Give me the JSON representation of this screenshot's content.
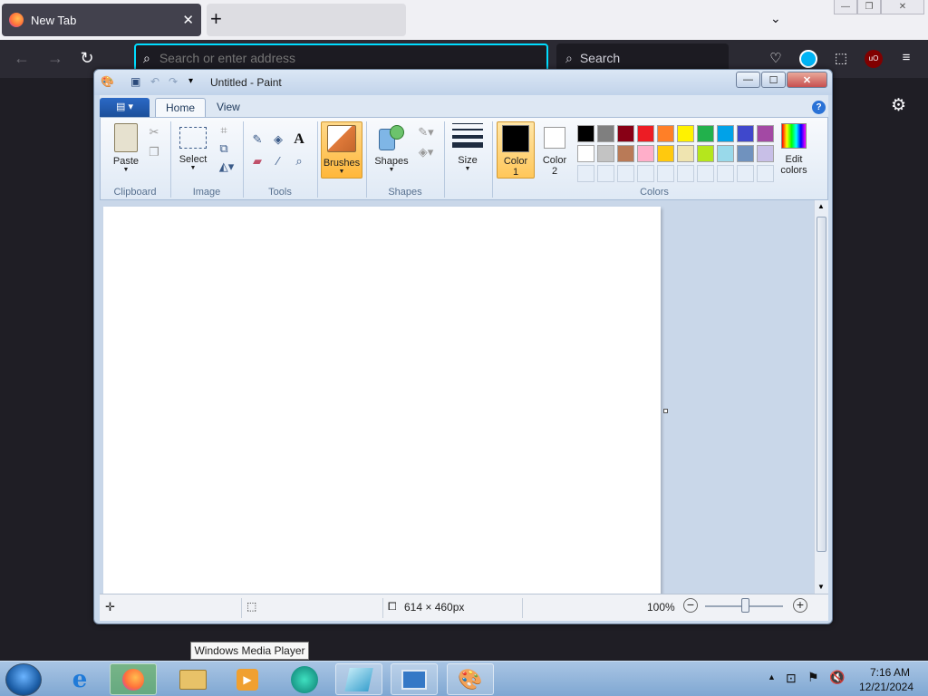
{
  "browser": {
    "tab_title": "New Tab",
    "tab_close": "✕",
    "new_tab": "+",
    "tab_list": "⌄",
    "window_controls": [
      "—",
      "❐",
      "✕"
    ],
    "address_placeholder": "Search or enter address",
    "search_label": "Search"
  },
  "paint": {
    "title": "Untitled - Paint",
    "window_controls": [
      "—",
      "☐",
      "✕"
    ],
    "tabs": {
      "home": "Home",
      "view": "View"
    },
    "help": "?",
    "clipboard": {
      "paste": "Paste",
      "group": "Clipboard"
    },
    "image": {
      "select": "Select",
      "group": "Image"
    },
    "tools": {
      "group": "Tools"
    },
    "brushes": {
      "label": "Brushes"
    },
    "shapes": {
      "label": "Shapes",
      "group": "Shapes"
    },
    "size": {
      "label": "Size"
    },
    "color1": {
      "label_line1": "Color",
      "label_line2": "1",
      "value": "#000000"
    },
    "color2": {
      "label_line1": "Color",
      "label_line2": "2",
      "value": "#ffffff"
    },
    "edit_colors": {
      "line1": "Edit",
      "line2": "colors"
    },
    "colors_group": "Colors",
    "palette_row1": [
      "#000000",
      "#7f7f7f",
      "#880015",
      "#ed1c24",
      "#ff7f27",
      "#fff200",
      "#22b14c",
      "#00a2e8",
      "#3f48cc",
      "#a349a4"
    ],
    "palette_row2": [
      "#ffffff",
      "#c3c3c3",
      "#b97a57",
      "#ffaec9",
      "#ffc90e",
      "#efe4b0",
      "#b5e61d",
      "#99d9ea",
      "#7092be",
      "#c8bfe7"
    ],
    "status": {
      "canvas_size": "614 × 460px",
      "zoom": "100%"
    }
  },
  "taskbar": {
    "tooltip": "Windows Media Player",
    "time": "7:16 AM",
    "date": "12/21/2024"
  }
}
